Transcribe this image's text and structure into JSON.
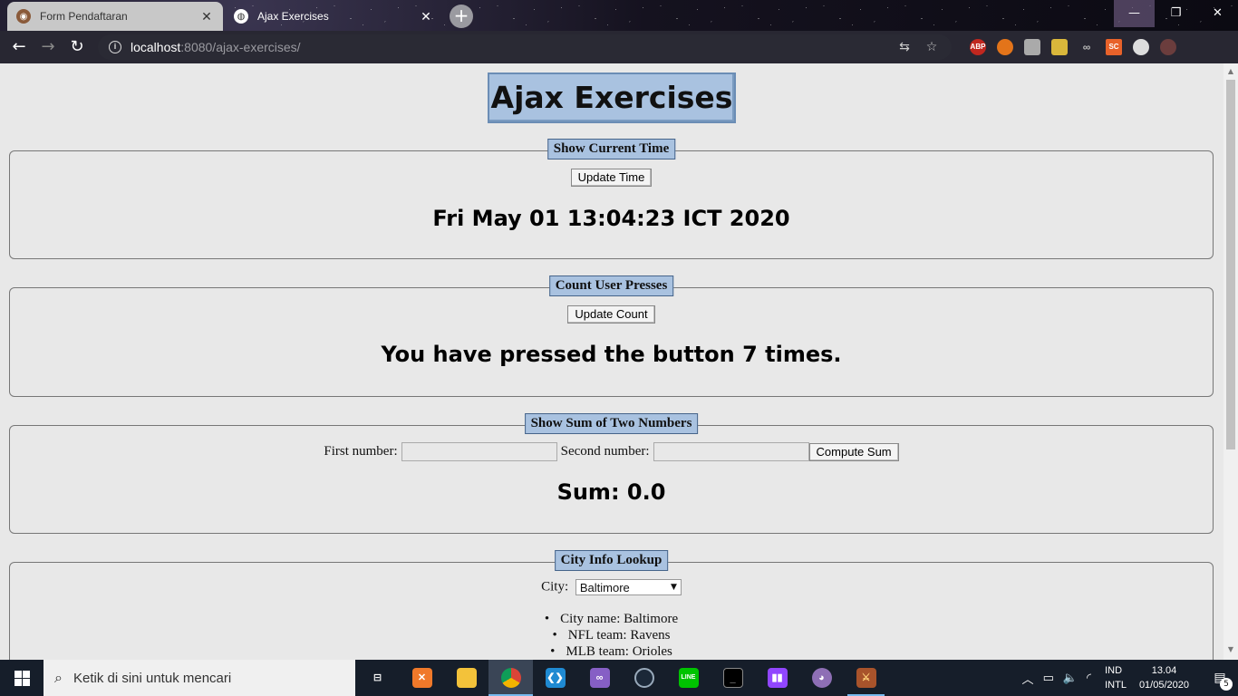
{
  "browser": {
    "tabs": [
      {
        "label": "Form Pendaftaran",
        "active": false
      },
      {
        "label": "Ajax Exercises",
        "active": true
      }
    ],
    "new_tab_symbol": "+",
    "url_host": "localhost",
    "url_rest": ":8080/ajax-exercises/",
    "window_controls": {
      "minimize": "—",
      "maximize": "❐",
      "close": "✕"
    },
    "extensions": [
      "ABP",
      "SC"
    ]
  },
  "page": {
    "title": "Ajax Exercises",
    "time_panel": {
      "legend": "Show Current Time",
      "button": "Update Time",
      "result": "Fri May 01 13:04:23 ICT 2020"
    },
    "count_panel": {
      "legend": "Count User Presses",
      "button": "Update Count",
      "result": "You have pressed the button 7 times."
    },
    "sum_panel": {
      "legend": "Show Sum of Two Numbers",
      "first_label": "First number:",
      "first_value": "",
      "second_label": "Second number:",
      "second_value": "",
      "button": "Compute Sum",
      "result": "Sum: 0.0"
    },
    "city_panel": {
      "legend": "City Info Lookup",
      "city_label": "City:",
      "selected_city": "Baltimore",
      "info": [
        "City name: Baltimore",
        "NFL team: Ravens",
        "MLB team: Orioles"
      ]
    }
  },
  "taskbar": {
    "search_placeholder": "Ketik di sini untuk mencari",
    "apps": [
      "task-view",
      "xampp",
      "file-explorer",
      "chrome",
      "vscode",
      "visual-studio",
      "steam",
      "line",
      "terminal",
      "twitch",
      "github-desktop",
      "game"
    ],
    "language_top": "IND",
    "language_bottom": "INTL",
    "time": "13.04",
    "date": "01/05/2020",
    "notification_count": "5"
  },
  "colors": {
    "legend_bg": "#a9c2e0",
    "page_bg": "#e8e8e8",
    "taskbar_bg": "#161e2a"
  }
}
